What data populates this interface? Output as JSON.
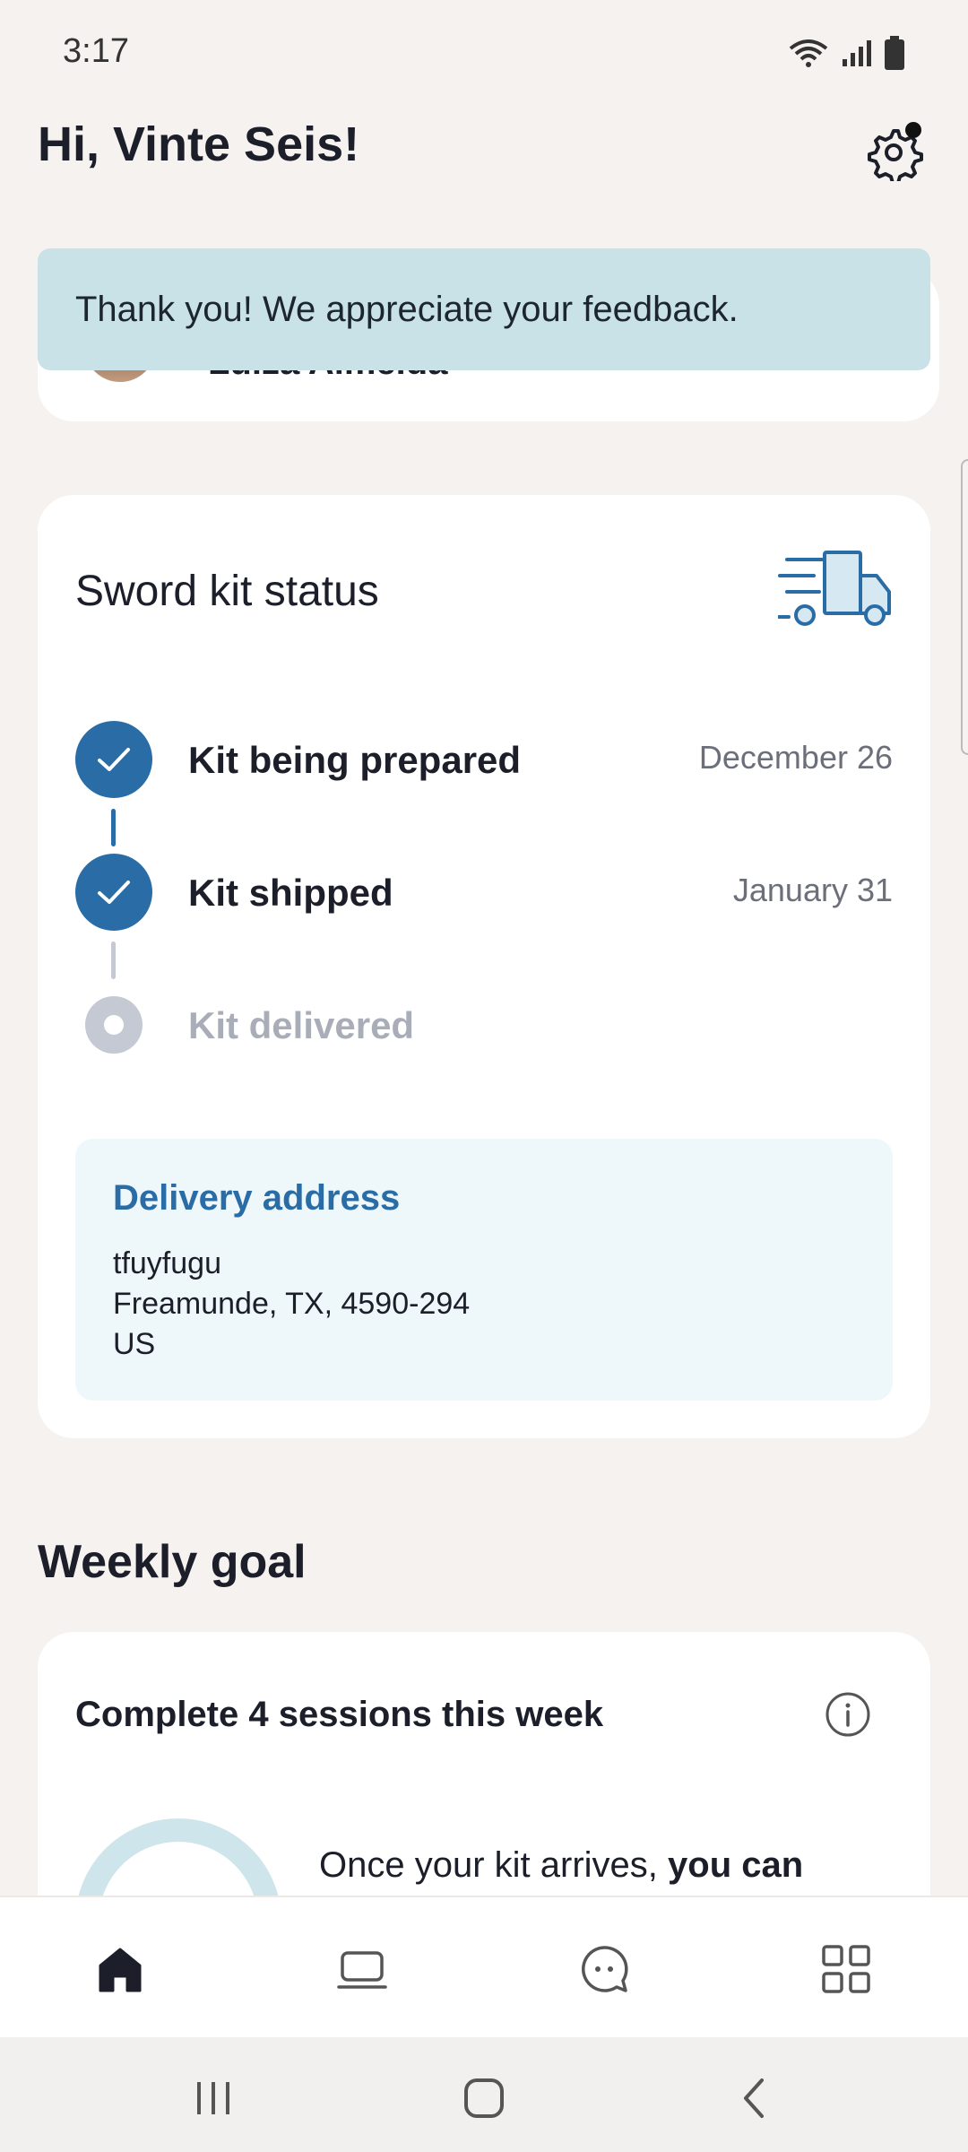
{
  "status_bar": {
    "time": "3:17"
  },
  "header": {
    "greeting": "Hi, Vinte Seis!"
  },
  "peek_card": {
    "name": "Luiza Almeida"
  },
  "toast": {
    "message": "Thank you! We appreciate your feedback."
  },
  "kit_status": {
    "title": "Sword kit status",
    "steps": [
      {
        "label": "Kit being prepared",
        "date": "December 26",
        "done": true
      },
      {
        "label": "Kit shipped",
        "date": "January 31",
        "done": true
      },
      {
        "label": "Kit delivered",
        "date": "",
        "done": false
      }
    ],
    "address": {
      "title": "Delivery address",
      "line1": "tfuyfugu",
      "line2": "Freamunde, TX, 4590-294",
      "line3": "US"
    }
  },
  "weekly_goal": {
    "section_title": "Weekly goal",
    "card_title": "Complete 4 sessions this week",
    "text_plain": "Once your kit arrives, ",
    "text_bold": "you can"
  },
  "colors": {
    "accent": "#2a6da6",
    "toast_bg": "#c9e2e8",
    "page_bg": "#f6f2ef"
  }
}
